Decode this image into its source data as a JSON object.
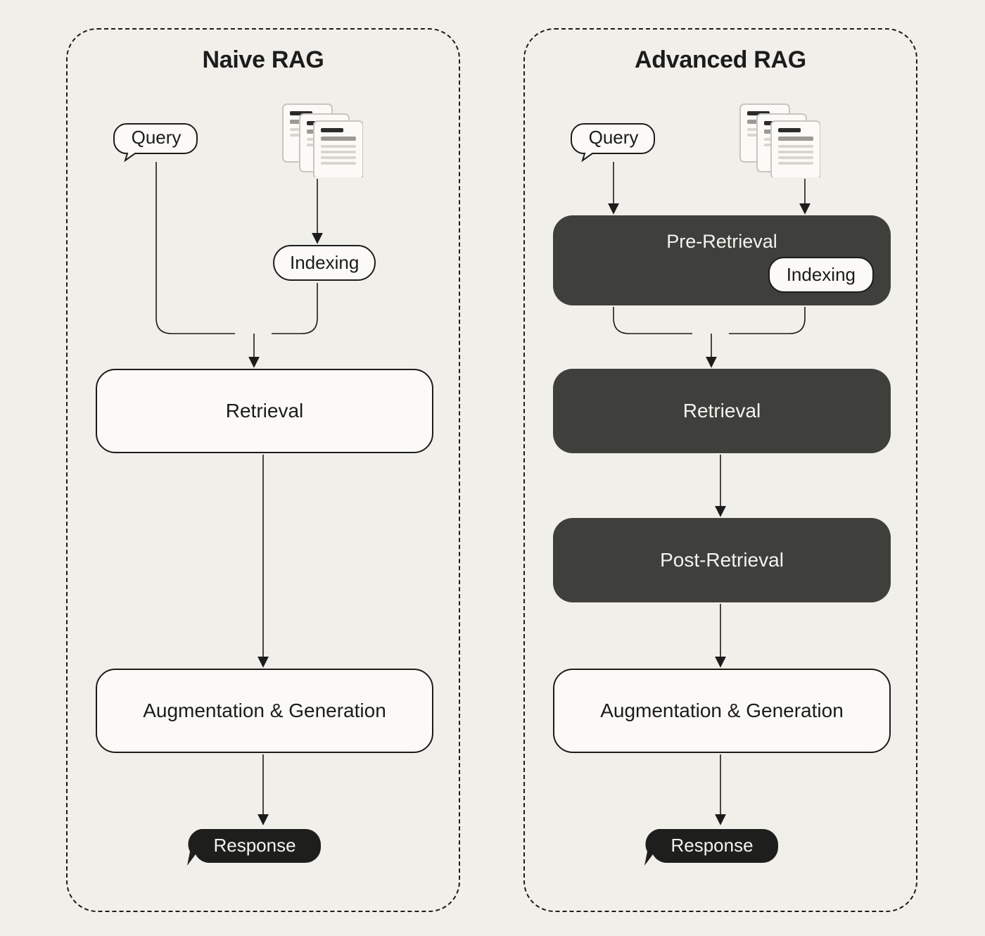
{
  "left": {
    "title": "Naive RAG",
    "query": "Query",
    "indexing": "Indexing",
    "retrieval": "Retrieval",
    "aug_gen": "Augmentation & Generation",
    "response": "Response"
  },
  "right": {
    "title": "Advanced RAG",
    "query": "Query",
    "pre_retrieval": "Pre-Retrieval",
    "indexing": "Indexing",
    "retrieval": "Retrieval",
    "post_retrieval": "Post-Retrieval",
    "aug_gen": "Augmentation & Generation",
    "response": "Response"
  },
  "colors": {
    "bg": "#f1efe9",
    "ink": "#1c1c1c",
    "dark_box": "#3f3f3c",
    "white_box": "#fbfaf6"
  }
}
